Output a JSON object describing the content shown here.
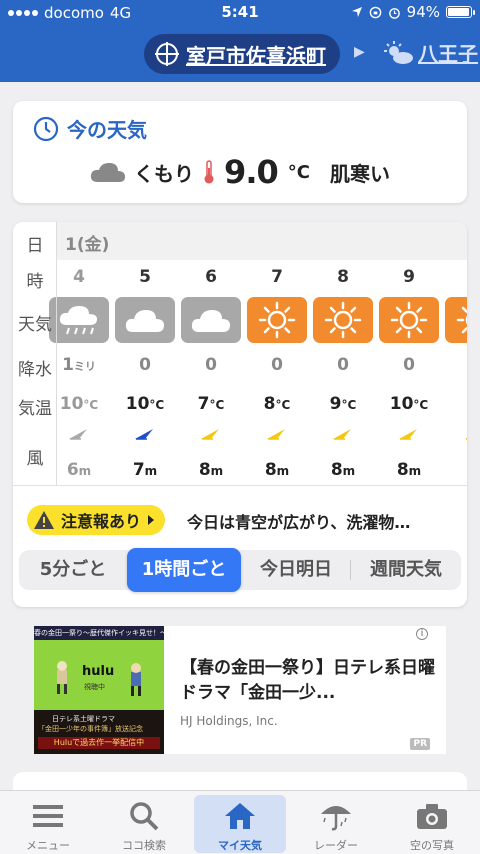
{
  "status": {
    "carrier": "docomo",
    "network": "4G",
    "time": "5:41",
    "battery": "94%",
    "battery_level": 0.94
  },
  "header": {
    "location": "室戸市佐喜浜町",
    "next_location": "八王子"
  },
  "current": {
    "title": "今の天気",
    "condition": "くもり",
    "temp": "9.0",
    "temp_unit": "°C",
    "feel": "肌寒い"
  },
  "hourly": {
    "labels": {
      "day": "日",
      "hour": "時",
      "weather": "天気",
      "precip": "降水",
      "temp": "気温",
      "wind": "風"
    },
    "date": "1(金)",
    "hours": [
      {
        "hour": "4",
        "weather": "rain",
        "precip": "1",
        "precip_unit": "ミリ",
        "temp": "10",
        "temp_unit": "°C",
        "wind": "6",
        "wind_unit": "m",
        "wind_color": "#aaaaaa"
      },
      {
        "hour": "5",
        "weather": "cloudy",
        "precip": "0",
        "temp": "10",
        "temp_unit": "°C",
        "wind": "7",
        "wind_unit": "m",
        "wind_color": "#1f4ec8"
      },
      {
        "hour": "6",
        "weather": "cloudy",
        "precip": "0",
        "temp": "7",
        "temp_unit": "°C",
        "wind": "8",
        "wind_unit": "m",
        "wind_color": "#f2c811"
      },
      {
        "hour": "7",
        "weather": "sunny",
        "precip": "0",
        "temp": "8",
        "temp_unit": "°C",
        "wind": "8",
        "wind_unit": "m",
        "wind_color": "#f2c811"
      },
      {
        "hour": "8",
        "weather": "sunny",
        "precip": "0",
        "temp": "9",
        "temp_unit": "°C",
        "wind": "8",
        "wind_unit": "m",
        "wind_color": "#f2c811"
      },
      {
        "hour": "9",
        "weather": "sunny",
        "precip": "0",
        "temp": "10",
        "temp_unit": "°C",
        "wind": "8",
        "wind_unit": "m",
        "wind_color": "#f2c811"
      },
      {
        "hour": "",
        "weather": "sunny",
        "precip": "",
        "temp": "1",
        "temp_unit": "",
        "wind": "",
        "wind_unit": "",
        "wind_color": "#f2c811"
      }
    ],
    "alert_label": "注意報あり",
    "alert_text": "今日は青空が広がり、洗濯物…",
    "tabs": [
      "5分ごと",
      "1時間ごと",
      "今日明日",
      "週間天気"
    ]
  },
  "colors": {
    "brand": "#2a66c4",
    "sunny_bg": "#f28a2e",
    "cloudy_bg": "#a8a8a8",
    "alert_bg": "#fbe12b"
  },
  "ad": {
    "banner_top": "春の金田一祭り〜歴代傑作イッキ見せ！〜",
    "banner_brand": "hulu",
    "banner_sub": "視聴中",
    "banner_line1": "日テレ系土曜ドラマ",
    "banner_line2": "「金田一少年の事件簿」放送記念",
    "banner_line3": "Huluで過去作一挙配信中",
    "title": "【春の金田一祭り】日テレ系日曜ドラマ「金田一少...",
    "advertiser": "HJ Holdings, Inc.",
    "pr": "PR",
    "info": "i"
  },
  "tabbar": [
    {
      "label": "メニュー",
      "icon": "menu-icon"
    },
    {
      "label": "ココ検索",
      "icon": "search-icon"
    },
    {
      "label": "マイ天気",
      "icon": "home-icon"
    },
    {
      "label": "レーダー",
      "icon": "umbrella-icon"
    },
    {
      "label": "空の写真",
      "icon": "camera-icon"
    }
  ]
}
